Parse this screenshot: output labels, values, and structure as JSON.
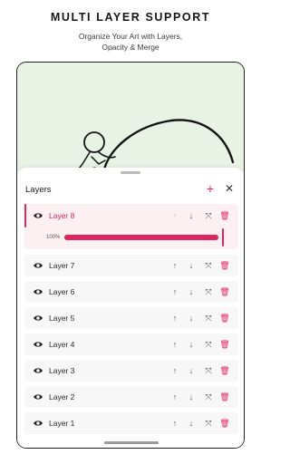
{
  "header": {
    "title": "MULTI LAYER SUPPORT",
    "subtitle_line1": "Organize Your Art with Layers,",
    "subtitle_line2": "Opacity & Merge"
  },
  "panel": {
    "title": "Layers",
    "add_icon": "plus-icon",
    "close_icon": "close-icon"
  },
  "active_layer": {
    "name": "Layer 8",
    "opacity_label": "100%",
    "opacity_value": 1.0
  },
  "layers": [
    {
      "name": "Layer 7"
    },
    {
      "name": "Layer 6"
    },
    {
      "name": "Layer 5"
    },
    {
      "name": "Layer 4"
    },
    {
      "name": "Layer 3"
    },
    {
      "name": "Layer 2"
    },
    {
      "name": "Layer 1"
    }
  ],
  "icons": {
    "visibility": "eye-icon",
    "move_up": "arrow-up-icon",
    "move_down": "arrow-down-icon",
    "merge": "merge-icon",
    "delete": "trash-icon"
  },
  "colors": {
    "accent": "#e0245e",
    "canvas_background": "#e8f3e5",
    "row_background": "#f7f7f7",
    "active_row_background": "#fdf0f3"
  }
}
